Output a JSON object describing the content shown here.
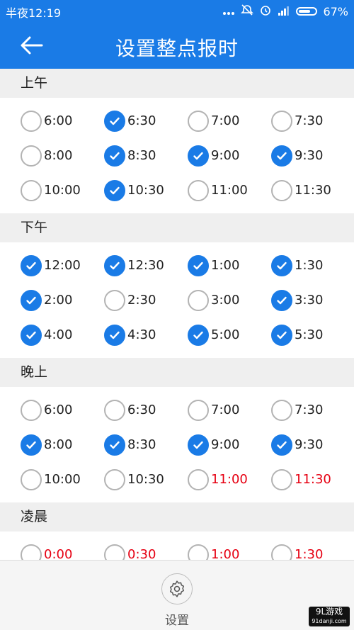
{
  "status_bar": {
    "time": "半夜12:19",
    "battery": "67%",
    "icons": [
      "more-dots-icon",
      "alarm-off-icon",
      "alarm-icon",
      "signal-icon",
      "battery-icon"
    ]
  },
  "app_bar": {
    "title": "设置整点报时",
    "back_icon": "back-arrow-icon"
  },
  "sections": [
    {
      "title": "上午",
      "items": [
        {
          "label": "6:00",
          "checked": false,
          "red": false
        },
        {
          "label": "6:30",
          "checked": true,
          "red": false
        },
        {
          "label": "7:00",
          "checked": false,
          "red": false
        },
        {
          "label": "7:30",
          "checked": false,
          "red": false
        },
        {
          "label": "8:00",
          "checked": false,
          "red": false
        },
        {
          "label": "8:30",
          "checked": true,
          "red": false
        },
        {
          "label": "9:00",
          "checked": true,
          "red": false
        },
        {
          "label": "9:30",
          "checked": true,
          "red": false
        },
        {
          "label": "10:00",
          "checked": false,
          "red": false
        },
        {
          "label": "10:30",
          "checked": true,
          "red": false
        },
        {
          "label": "11:00",
          "checked": false,
          "red": false
        },
        {
          "label": "11:30",
          "checked": false,
          "red": false
        }
      ]
    },
    {
      "title": "下午",
      "items": [
        {
          "label": "12:00",
          "checked": true,
          "red": false
        },
        {
          "label": "12:30",
          "checked": true,
          "red": false
        },
        {
          "label": "1:00",
          "checked": true,
          "red": false
        },
        {
          "label": "1:30",
          "checked": true,
          "red": false
        },
        {
          "label": "2:00",
          "checked": true,
          "red": false
        },
        {
          "label": "2:30",
          "checked": false,
          "red": false
        },
        {
          "label": "3:00",
          "checked": false,
          "red": false
        },
        {
          "label": "3:30",
          "checked": true,
          "red": false
        },
        {
          "label": "4:00",
          "checked": true,
          "red": false
        },
        {
          "label": "4:30",
          "checked": true,
          "red": false
        },
        {
          "label": "5:00",
          "checked": true,
          "red": false
        },
        {
          "label": "5:30",
          "checked": true,
          "red": false
        }
      ]
    },
    {
      "title": "晚上",
      "items": [
        {
          "label": "6:00",
          "checked": false,
          "red": false
        },
        {
          "label": "6:30",
          "checked": false,
          "red": false
        },
        {
          "label": "7:00",
          "checked": false,
          "red": false
        },
        {
          "label": "7:30",
          "checked": false,
          "red": false
        },
        {
          "label": "8:00",
          "checked": true,
          "red": false
        },
        {
          "label": "8:30",
          "checked": true,
          "red": false
        },
        {
          "label": "9:00",
          "checked": true,
          "red": false
        },
        {
          "label": "9:30",
          "checked": true,
          "red": false
        },
        {
          "label": "10:00",
          "checked": false,
          "red": false
        },
        {
          "label": "10:30",
          "checked": false,
          "red": false
        },
        {
          "label": "11:00",
          "checked": false,
          "red": true
        },
        {
          "label": "11:30",
          "checked": false,
          "red": true
        }
      ]
    },
    {
      "title": "凌晨",
      "items": [
        {
          "label": "0:00",
          "checked": false,
          "red": true
        },
        {
          "label": "0:30",
          "checked": false,
          "red": true
        },
        {
          "label": "1:00",
          "checked": false,
          "red": true
        },
        {
          "label": "1:30",
          "checked": false,
          "red": true
        }
      ]
    }
  ],
  "bottom_bar": {
    "settings_label": "设置",
    "settings_icon": "gear-icon"
  },
  "watermark": {
    "line1": "9L游戏",
    "line2": "91danji.com"
  },
  "colors": {
    "primary": "#1a7be6",
    "red_text": "#e60012",
    "section_bg": "#efefef",
    "unchecked_border": "#b3b3b3"
  }
}
